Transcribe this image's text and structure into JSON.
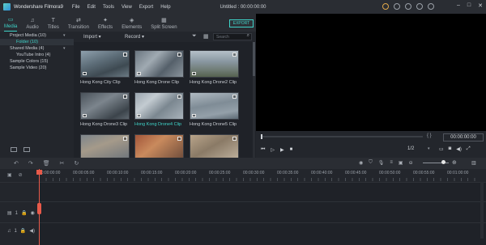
{
  "app": {
    "name": "Wondershare Filmora9",
    "window_title": "Untitled : 00:00:00:00",
    "menu": [
      "File",
      "Edit",
      "Tools",
      "View",
      "Export",
      "Help"
    ],
    "window_controls": [
      "–",
      "□",
      "✕"
    ],
    "accent": "#3fd3c8"
  },
  "tabs": [
    {
      "label": "Media",
      "icon": "folder-icon",
      "glyph": "▭"
    },
    {
      "label": "Audio",
      "icon": "music-icon",
      "glyph": "♫"
    },
    {
      "label": "Titles",
      "icon": "text-icon",
      "glyph": "T"
    },
    {
      "label": "Transition",
      "icon": "transition-icon",
      "glyph": "⇄"
    },
    {
      "label": "Effects",
      "icon": "effects-icon",
      "glyph": "✦"
    },
    {
      "label": "Elements",
      "icon": "elements-icon",
      "glyph": "◈"
    },
    {
      "label": "Split Screen",
      "icon": "split-screen-icon",
      "glyph": "▦"
    }
  ],
  "export_label": "EXPORT",
  "sidebar": {
    "items": [
      {
        "label": "Project Media (10)",
        "sub": false,
        "selected": false
      },
      {
        "label": "Folder (10)",
        "sub": true,
        "selected": true
      },
      {
        "label": "Shared Media (4)",
        "sub": false,
        "selected": false
      },
      {
        "label": "YouTube Intro (4)",
        "sub": true,
        "selected": false
      },
      {
        "label": "Sample Colors (15)",
        "sub": false,
        "selected": false
      },
      {
        "label": "Sample Video (20)",
        "sub": false,
        "selected": false
      }
    ]
  },
  "media_toolbar": {
    "import_label": "Import",
    "record_label": "Record",
    "search_placeholder": "Search"
  },
  "clips": [
    {
      "name": "Hong Kong City Clip",
      "active": false
    },
    {
      "name": "Hong Kong Drone Clip",
      "active": false
    },
    {
      "name": "Hong Kong Drone2 Clip",
      "active": false
    },
    {
      "name": "Hong Kong Drone3 Clip",
      "active": false
    },
    {
      "name": "Hong Kong Drone4 Clip",
      "active": true
    },
    {
      "name": "Hong Kong Drone5 Clip",
      "active": false
    },
    {
      "name": "",
      "active": false
    },
    {
      "name": "",
      "active": false
    },
    {
      "name": "",
      "active": false
    }
  ],
  "player": {
    "timecode": "00:00:00:00",
    "ratio": "1/2",
    "braces": "{   }"
  },
  "timeline": {
    "ruler_labels": [
      "00:00:00:00",
      "00:00:05:00",
      "00:00:10:00",
      "00:00:15:00",
      "00:00:20:00",
      "00:00:25:00",
      "00:00:30:00",
      "00:00:35:00",
      "00:00:40:00",
      "00:00:45:00",
      "00:00:50:00",
      "00:00:55:00",
      "00:01:00:00"
    ],
    "video_track_num": "1",
    "audio_track_num": "1"
  }
}
